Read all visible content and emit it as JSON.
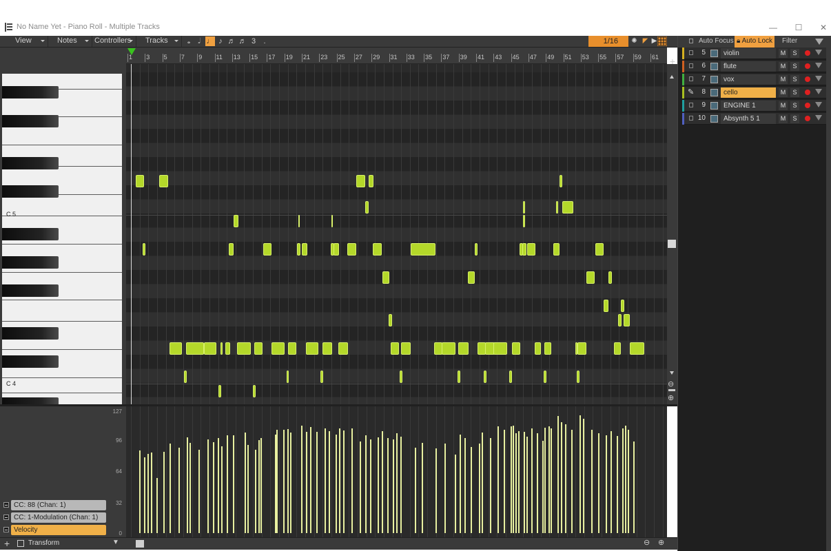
{
  "window": {
    "title": "No Name Yet - Piano Roll - Multiple Tracks",
    "minimize": "—",
    "maximize": "☐",
    "close": "✕"
  },
  "toolbar": {
    "menus": [
      "View",
      "Notes",
      "Controllers",
      "Tracks"
    ],
    "note_durations": [
      "𝅝",
      "𝅗𝅥",
      "♩",
      "♪",
      "♬",
      "♬",
      "3",
      "."
    ],
    "active_duration_index": 3,
    "snap_value": "1/16"
  },
  "ruler": {
    "labels": [
      "1",
      "3",
      "5",
      "7",
      "9",
      "11",
      "13",
      "15",
      "17",
      "19",
      "21",
      "23",
      "25",
      "27",
      "29",
      "31",
      "33",
      "35",
      "37",
      "39",
      "41",
      "43",
      "45",
      "47",
      "49",
      "51",
      "53",
      "55",
      "57",
      "59",
      "61"
    ]
  },
  "keyboard": {
    "c5_label": "C 5",
    "c4_label": "C 4"
  },
  "controllers": {
    "axis": [
      "127",
      "96",
      "64",
      "32",
      "0"
    ],
    "lanes": [
      {
        "label": "CC: 88 (Chan: 1)",
        "active": false
      },
      {
        "label": "CC: 1-Modulation (Chan: 1)",
        "active": false
      },
      {
        "label": "Velocity",
        "active": true
      }
    ],
    "transform_label": "Transform"
  },
  "track_pane": {
    "auto_focus": "Auto Focus",
    "auto_lock": "Auto Lock",
    "filter": "Filter",
    "tracks": [
      {
        "num": "5",
        "name": "violin",
        "color": "#d4b020",
        "active": false
      },
      {
        "num": "6",
        "name": "flute",
        "color": "#d06020",
        "active": false
      },
      {
        "num": "7",
        "name": "vox",
        "color": "#40b040",
        "active": false
      },
      {
        "num": "8",
        "name": "cello",
        "color": "#a8c020",
        "active": true
      },
      {
        "num": "9",
        "name": "ENGINE 1",
        "color": "#20a0a0",
        "active": false
      },
      {
        "num": "10",
        "name": "Absynth 5 1",
        "color": "#5060c0",
        "active": false
      }
    ],
    "mute": "M",
    "solo": "S"
  },
  "colors": {
    "note": "#b4d82a",
    "accent": "#f0a040",
    "background": "#2a2a2a"
  }
}
